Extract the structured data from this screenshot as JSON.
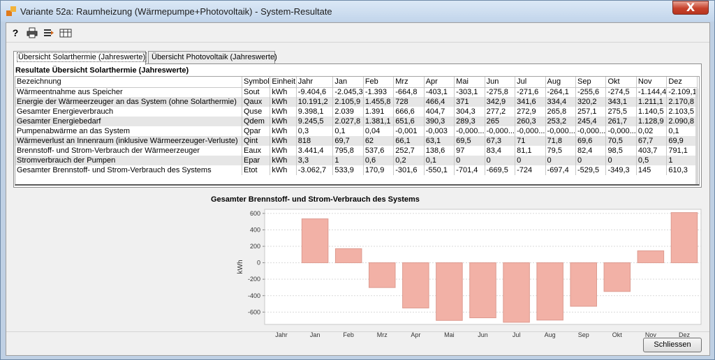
{
  "window": {
    "title": "Variante 52a: Raumheizung (Wärmepumpe+Photovoltaik) - System-Resultate",
    "close_glyph": "X"
  },
  "toolbar": {
    "items": [
      {
        "icon": "help-icon",
        "glyph": "?"
      },
      {
        "icon": "print-icon"
      },
      {
        "icon": "export-icon"
      },
      {
        "icon": "print-preview-icon"
      }
    ]
  },
  "tabs": [
    {
      "label": "Übersicht Solarthermie (Jahreswerte)",
      "active": true
    },
    {
      "label": "Übersicht Photovoltaik (Jahreswerte)",
      "active": false
    }
  ],
  "panel": {
    "title": "Resultate Übersicht Solarthermie (Jahreswerte)"
  },
  "table": {
    "headers": [
      "Bezeichnung",
      "Symbol",
      "Einheit",
      "Jahr",
      "Jan",
      "Feb",
      "Mrz",
      "Apr",
      "Mai",
      "Jun",
      "Jul",
      "Aug",
      "Sep",
      "Okt",
      "Nov",
      "Dez"
    ],
    "rows": [
      [
        "Wärmeentnahme aus Speicher",
        "Sout",
        "kWh",
        "-9.404,6",
        "-2.045,3",
        "-1.393",
        "-664,8",
        "-403,1",
        "-303,1",
        "-275,8",
        "-271,6",
        "-264,1",
        "-255,6",
        "-274,5",
        "-1.144,4",
        "-2.109,1"
      ],
      [
        "Energie der Wärmeerzeuger an das System (ohne Solarthermie)",
        "Qaux",
        "kWh",
        "10.191,2",
        "2.105,9",
        "1.455,8",
        "728",
        "466,4",
        "371",
        "342,9",
        "341,6",
        "334,4",
        "320,2",
        "343,1",
        "1.211,1",
        "2.170,8"
      ],
      [
        "Gesamter Energieverbrauch",
        "Quse",
        "kWh",
        "9.398,1",
        "2.039",
        "1.391",
        "666,6",
        "404,7",
        "304,3",
        "277,2",
        "272,9",
        "265,8",
        "257,1",
        "275,5",
        "1.140,5",
        "2.103,5"
      ],
      [
        "Gesamter Energiebedarf",
        "Qdem",
        "kWh",
        "9.245,5",
        "2.027,8",
        "1.381,1",
        "651,6",
        "390,3",
        "289,3",
        "265",
        "260,3",
        "253,2",
        "245,4",
        "261,7",
        "1.128,9",
        "2.090,8"
      ],
      [
        "Pumpenabwärme an das System",
        "Qpar",
        "kWh",
        "0,3",
        "0,1",
        "0,04",
        "-0,001",
        "-0,003",
        "-0,000...",
        "-0,000...",
        "-0,000...",
        "-0,000...",
        "-0,000...",
        "-0,000...",
        "0,02",
        "0,1"
      ],
      [
        "Wärmeverlust an Innenraum (inklusive Wärmeerzeuger-Verluste)",
        "Qint",
        "kWh",
        "818",
        "69,7",
        "62",
        "66,1",
        "63,1",
        "69,5",
        "67,3",
        "71",
        "71,8",
        "69,6",
        "70,5",
        "67,7",
        "69,9"
      ],
      [
        "Brennstoff- und Strom-Verbrauch der Wärmeerzeuger",
        "Eaux",
        "kWh",
        "3.441,4",
        "795,8",
        "537,6",
        "252,7",
        "138,6",
        "97",
        "83,4",
        "81,1",
        "79,5",
        "82,4",
        "98,5",
        "403,7",
        "791,1"
      ],
      [
        "Stromverbrauch der Pumpen",
        "Epar",
        "kWh",
        "3,3",
        "1",
        "0,6",
        "0,2",
        "0,1",
        "0",
        "0",
        "0",
        "0",
        "0",
        "0",
        "0,5",
        "1"
      ],
      [
        "Gesamter Brennstoff- und Strom-Verbrauch des Systems",
        "Etot",
        "kWh",
        "-3.062,7",
        "533,9",
        "170,9",
        "-301,6",
        "-550,1",
        "-701,4",
        "-669,5",
        "-724",
        "-697,4",
        "-529,5",
        "-349,3",
        "145",
        "610,3"
      ]
    ]
  },
  "chart_data": {
    "type": "bar",
    "title": "Gesamter Brennstoff- und Strom-Verbrauch des Systems",
    "ylabel": "kWh",
    "xlabel": "",
    "categories": [
      "Jahr",
      "Jan",
      "Feb",
      "Mrz",
      "Apr",
      "Mai",
      "Jun",
      "Jul",
      "Aug",
      "Sep",
      "Okt",
      "Nov",
      "Dez"
    ],
    "values": [
      null,
      533.9,
      170.9,
      -301.6,
      -550.1,
      -701.4,
      -669.5,
      -724,
      -697.4,
      -529.5,
      -349.3,
      145,
      610.3
    ],
    "ylim": [
      -750,
      650
    ],
    "yticks": [
      600,
      400,
      200,
      0,
      -200,
      -400,
      -600
    ],
    "ytick_labels": [
      "600",
      "400",
      "200",
      "0",
      "-200",
      "-400",
      "-600"
    ],
    "grid": true,
    "bar_color": "#f2b1a6",
    "bar_border_color": "#dd9a8f"
  },
  "footer": {
    "close_label": "Schliessen"
  }
}
